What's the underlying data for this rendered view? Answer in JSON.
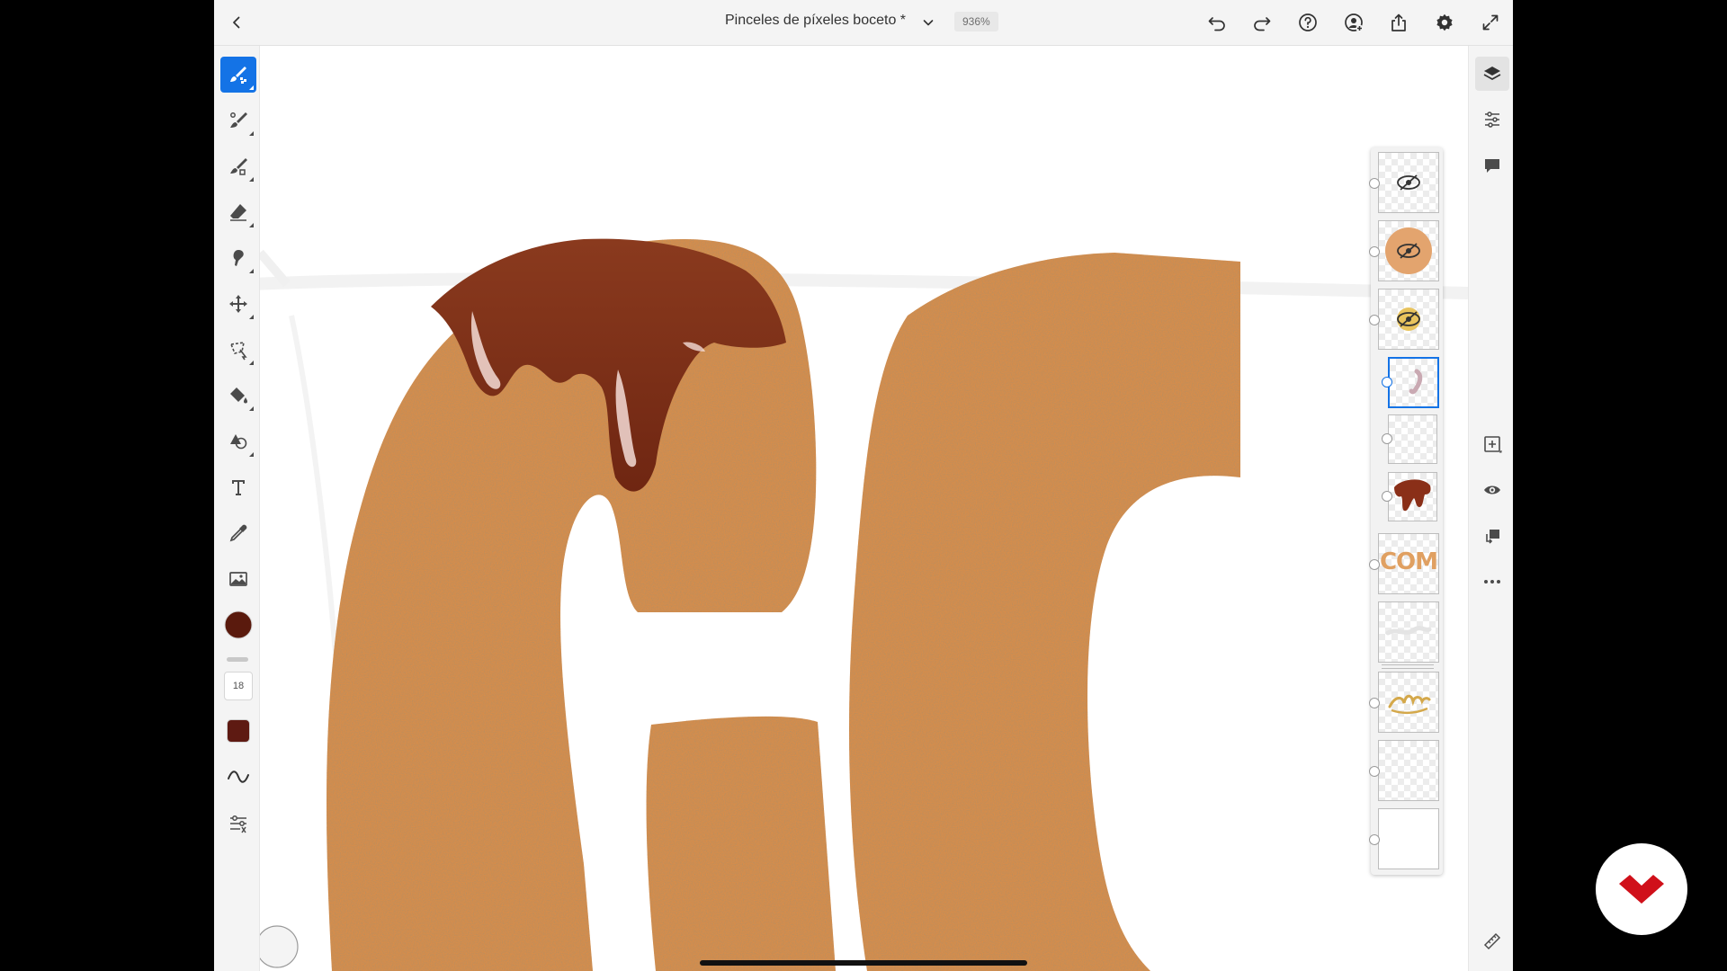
{
  "header": {
    "document_title": "Pinceles de píxeles boceto *",
    "zoom": "936%"
  },
  "toolbar": {
    "brush_size": "18",
    "primary_color": "#5a1a0d",
    "secondary_color": "#5e1a12",
    "accent_color": "#1473e6"
  },
  "layers": {
    "title_thumb_text": "COM"
  }
}
